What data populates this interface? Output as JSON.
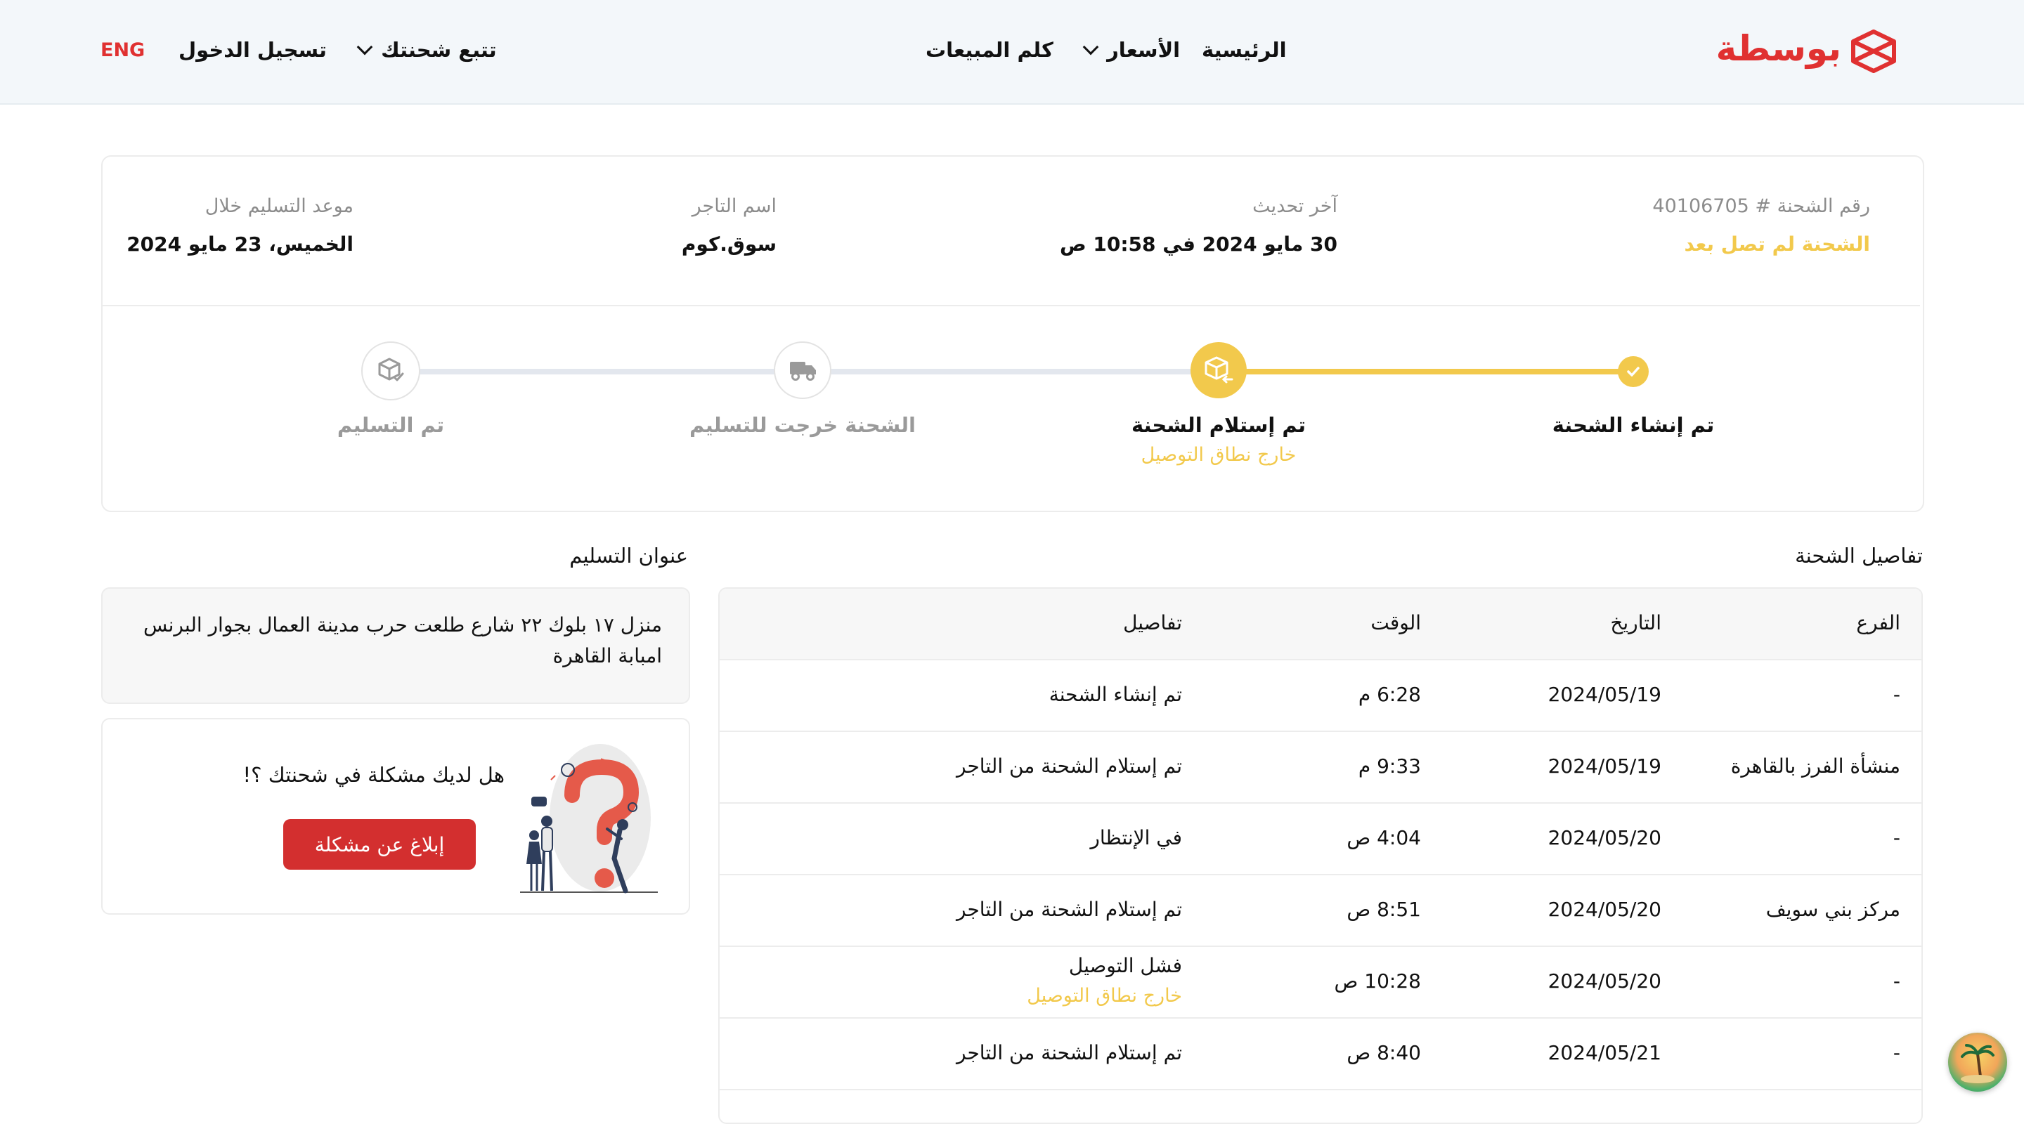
{
  "header": {
    "logo_text": "بوسطة",
    "nav": {
      "home": "الرئيسية",
      "prices": "الأسعار",
      "talk_sales": "كلم المبيعات",
      "track": "تتبع شحنتك",
      "login": "تسجيل الدخول",
      "lang": "ENG"
    }
  },
  "summary": {
    "shipment_label": "رقم الشحنة # 40106705",
    "shipment_status": "الشحنة لم تصل بعد",
    "last_update_label": "آخر تحديث",
    "last_update_value": "30 مايو 2024 في 10:58 ص",
    "merchant_label": "اسم التاجر",
    "merchant_value": "سوق.كوم",
    "delivery_label": "موعد التسليم خلال",
    "delivery_value": "الخميس، 23 مايو 2024"
  },
  "tracker": {
    "steps": [
      {
        "label": "تم إنشاء الشحنة",
        "sub": ""
      },
      {
        "label": "تم إستلام الشحنة",
        "sub": "خارج نطاق التوصيل"
      },
      {
        "label": "الشحنة خرجت للتسليم",
        "sub": ""
      },
      {
        "label": "تم التسليم",
        "sub": ""
      }
    ],
    "progress": 0.33
  },
  "details": {
    "title": "تفاصيل الشحنة",
    "columns": {
      "branch": "الفرع",
      "date": "التاريخ",
      "time": "الوقت",
      "details": "تفاصيل"
    },
    "rows": [
      {
        "branch": "-",
        "date": "2024/05/19",
        "time": "6:28 م",
        "details": "تم إنشاء الشحنة",
        "sub": ""
      },
      {
        "branch": "منشأة الفرز بالقاهرة",
        "date": "2024/05/19",
        "time": "9:33 م",
        "details": "تم إستلام الشحنة من التاجر",
        "sub": ""
      },
      {
        "branch": "-",
        "date": "2024/05/20",
        "time": "4:04 ص",
        "details": "في الإنتظار",
        "sub": ""
      },
      {
        "branch": "مركز بني سويف",
        "date": "2024/05/20",
        "time": "8:51 ص",
        "details": "تم إستلام الشحنة من التاجر",
        "sub": ""
      },
      {
        "branch": "-",
        "date": "2024/05/20",
        "time": "10:28 ص",
        "details": "فشل التوصيل",
        "sub": "خارج نطاق التوصيل"
      },
      {
        "branch": "-",
        "date": "2024/05/21",
        "time": "8:40 ص",
        "details": "تم إستلام الشحنة من التاجر",
        "sub": ""
      }
    ]
  },
  "address": {
    "title": "عنوان التسليم",
    "line1": "منزل ١٧ بلوك ٢٢ شارع طلعت حرب مدينة العمال بجوار البرنس",
    "line2": "امبابة القاهرة"
  },
  "problem": {
    "question": "هل لديك مشكلة في شحنتك ؟!",
    "button": "إبلاغ عن مشكلة"
  },
  "colors": {
    "brand_red": "#e03131",
    "accent_yellow": "#f2c94c",
    "button_red": "#d32f2f"
  }
}
